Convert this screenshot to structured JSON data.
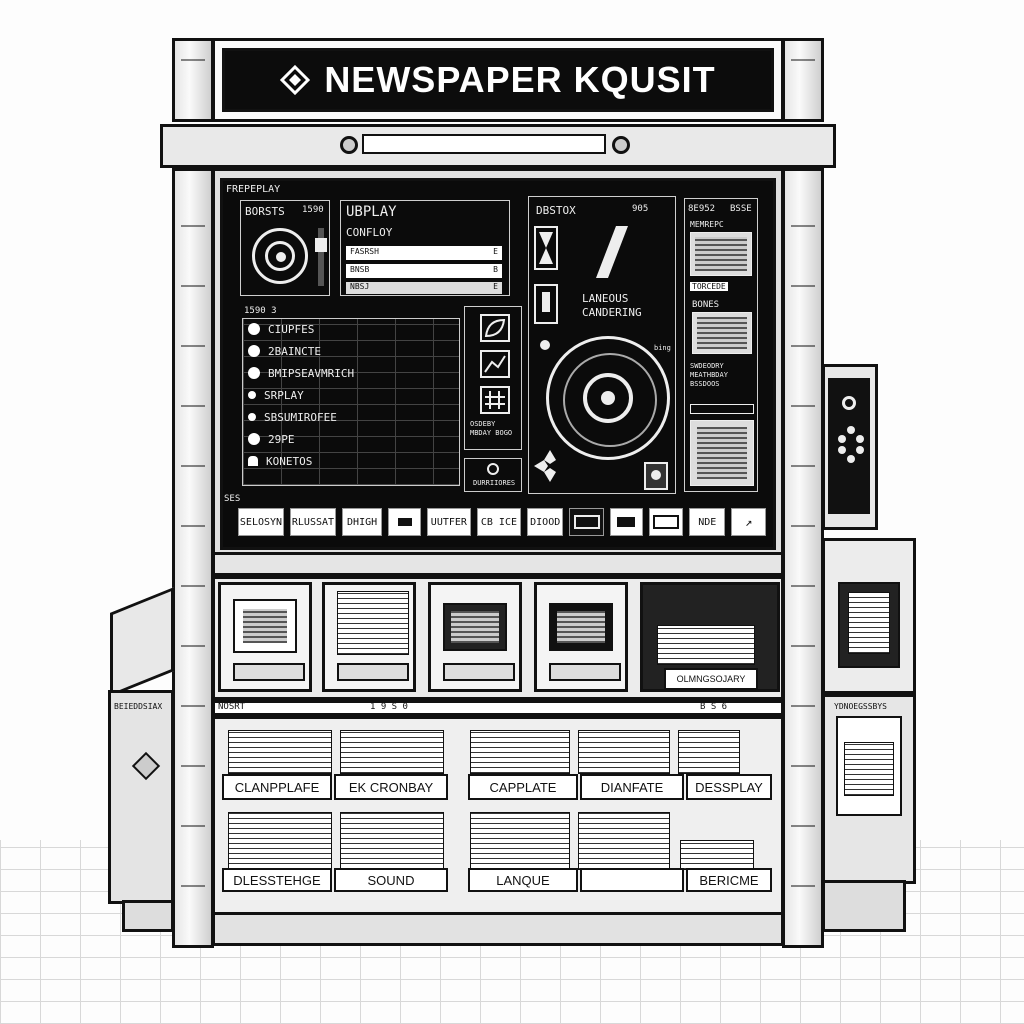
{
  "banner": {
    "icon": "diamond-logo-icon",
    "title": "NEWSPAPER KQUSIT"
  },
  "screen": {
    "corner_label": "FREPEPLAY",
    "top_left": {
      "title_a": "BORSTS",
      "title_b": "1590"
    },
    "display_panel": {
      "title": "UBPLAY",
      "subtitle": "CONFLOY",
      "fields": [
        "FASRSH",
        "BNSB",
        "NBSJ"
      ],
      "field_marks": [
        "E",
        "B",
        "E"
      ]
    },
    "menu_header": "1590 3",
    "menu_items": [
      "CIUPFES",
      "2BAINCTE",
      "BMIPSEAVMRICH",
      "SRPLAY",
      "SBSUMIROFEE",
      "29PE",
      "KONETOS"
    ],
    "mid_panel": {
      "title_a": "DBSTOX",
      "title_b": "905",
      "label_a": "LANEOUS",
      "label_b": "CANDERING",
      "side": "bing"
    },
    "right_panel": {
      "title_a": "8E952",
      "title_b": "BSSE",
      "label_a": "MEMREPC",
      "label_b": "TORCEDE",
      "label_c": "BONES",
      "label_d": "SWDEODRY MEATHBDAY BSSDOOS"
    },
    "icon_panel_caption": "OSDEBY MBDAY BOGO",
    "footer_btn": "DURRIIORES",
    "menu_prefix": "SES",
    "bottom_menu": [
      "SELOSYN",
      "RLUSSAT",
      "DHIGH",
      "",
      "UUTFER",
      "CB ICE",
      "DIOOD",
      "",
      "",
      "",
      "NDE",
      ""
    ]
  },
  "slots": {
    "labels": [
      "OLMNGSOJARY"
    ]
  },
  "shelf": {
    "top_marks": [
      "NOSRT",
      "1 9 S 0",
      "B S 6"
    ],
    "row1": [
      "CLANPPLAFE",
      "EK CRONBAY",
      "CAPPLATE",
      "DIANFATE",
      "DESSPLAY"
    ],
    "row2": [
      "DLESSTEHGE",
      "SOUND",
      "LANQUE",
      "",
      "BERICME"
    ]
  },
  "side_left": {
    "label": "BEIEDDSIAX"
  },
  "side_right": {
    "label": "YDNOEGSSBYS"
  },
  "colors": {
    "screen": "#0b0b0b",
    "frame": "#111111",
    "panel": "#f2f2f2"
  }
}
